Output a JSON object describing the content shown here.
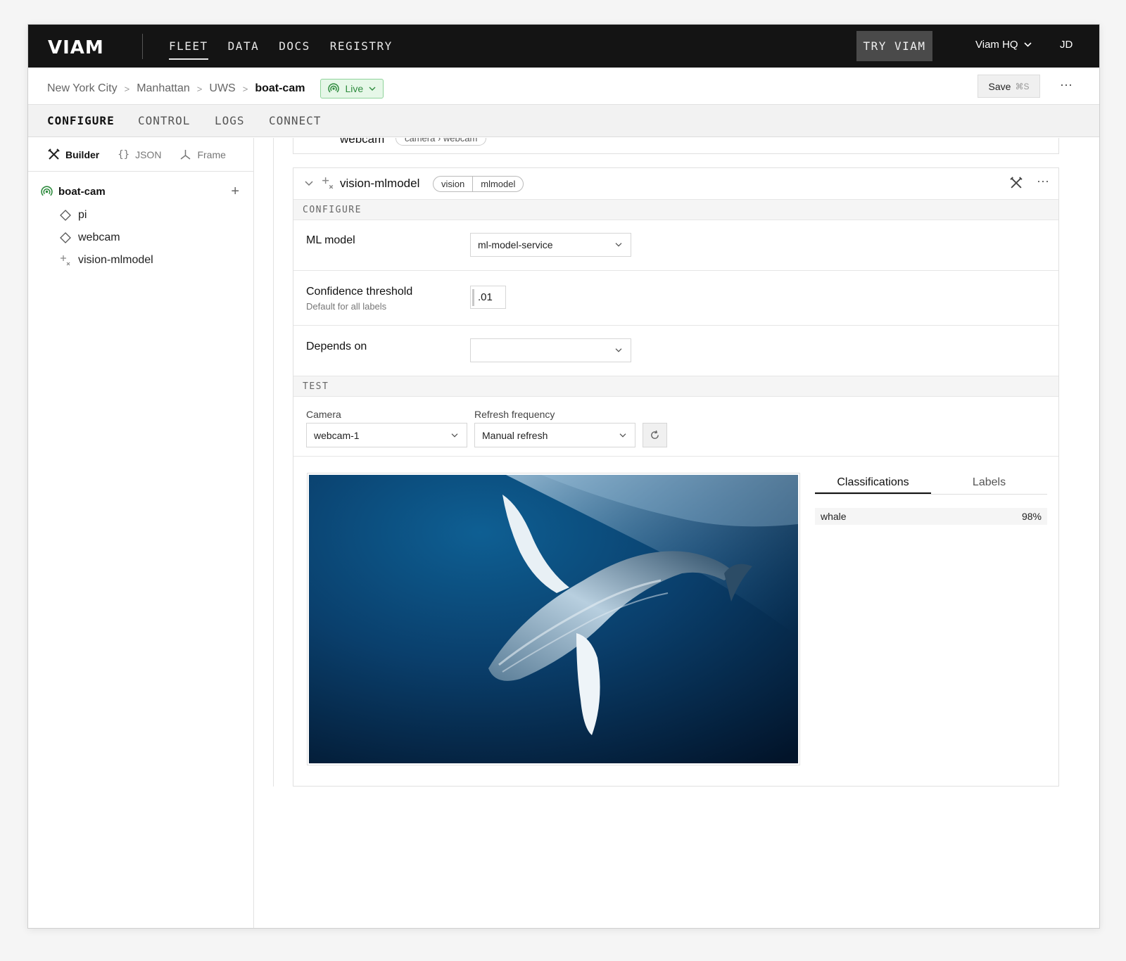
{
  "app": {
    "logo": "VIAM",
    "nav": [
      "FLEET",
      "DATA",
      "DOCS",
      "REGISTRY"
    ],
    "try_button": "TRY VIAM",
    "org": "Viam HQ",
    "user": "JD"
  },
  "breadcrumb": {
    "items": [
      "New York City",
      "Manhattan",
      "UWS"
    ],
    "current": "boat-cam",
    "status": "Live",
    "save_label": "Save",
    "save_shortcut": "⌘S"
  },
  "tabs": [
    "CONFIGURE",
    "CONTROL",
    "LOGS",
    "CONNECT"
  ],
  "sidebar": {
    "modes": [
      "Builder",
      "JSON",
      "Frame"
    ],
    "root": "boat-cam",
    "items": [
      {
        "label": "pi",
        "icon": "diamond-icon"
      },
      {
        "label": "webcam",
        "icon": "diamond-icon"
      },
      {
        "label": "vision-mlmodel",
        "icon": "sparkle-icon"
      }
    ]
  },
  "prev_card": {
    "name": "webcam",
    "api": "camera",
    "model": "webcam"
  },
  "card": {
    "name": "vision-mlmodel",
    "api": "vision",
    "model": "mlmodel",
    "configure_title": "CONFIGURE",
    "ml_model_label": "ML model",
    "ml_model_value": "ml-model-service",
    "confidence_label": "Confidence threshold",
    "confidence_sub": "Default for all labels",
    "confidence_value": ".01",
    "depends_label": "Depends on",
    "depends_value": "",
    "test_title": "TEST",
    "camera_label": "Camera",
    "camera_value": "webcam-1",
    "refresh_label": "Refresh frequency",
    "refresh_value": "Manual refresh"
  },
  "results": {
    "tabs": [
      "Classifications",
      "Labels"
    ],
    "rows": [
      {
        "label": "whale",
        "confidence": "98%"
      }
    ]
  },
  "colors": {
    "nav_bg": "#141414",
    "live_green": "#2e8b3e",
    "live_bg": "#e6f7e8",
    "ocean_deep": "#031a33",
    "ocean_mid": "#0b4d7a"
  }
}
